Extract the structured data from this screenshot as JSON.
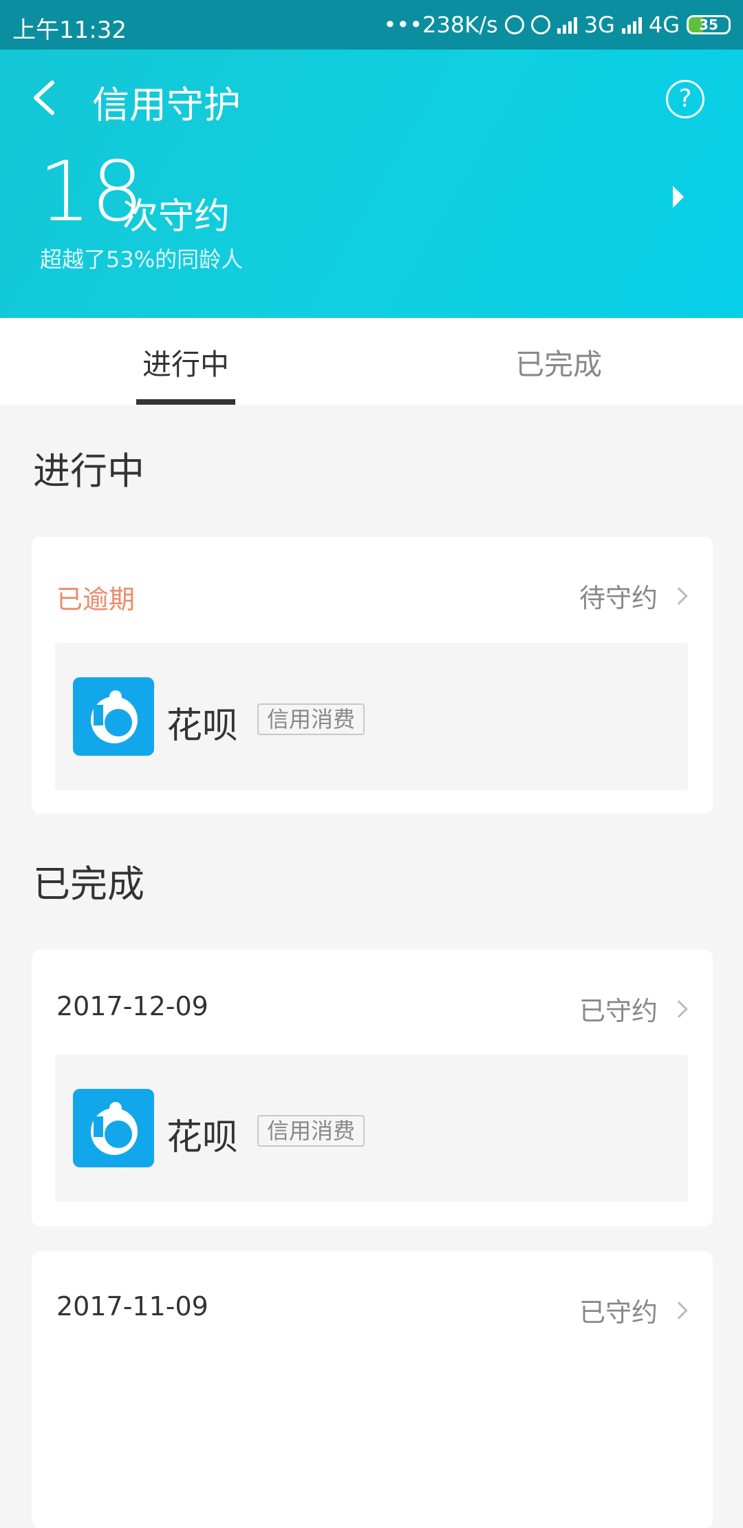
{
  "status_bar": {
    "time": "上午11:32",
    "speed": "•••238K/s",
    "network_3g": "3G",
    "network_4g": "4G",
    "battery": "35"
  },
  "header": {
    "title": "信用守护",
    "help_label": "?",
    "stats_number": "18",
    "stats_unit": "次守约",
    "stats_sub": "超越了53%的同龄人"
  },
  "tabs": [
    {
      "label": "进行中",
      "active": true
    },
    {
      "label": "已完成",
      "active": false
    }
  ],
  "sections": {
    "ongoing_title": "进行中",
    "done_title": "已完成"
  },
  "cards": [
    {
      "left_text": "已逾期",
      "right_text": "待守约",
      "app_name": "花呗",
      "app_tag": "信用消费"
    },
    {
      "left_text": "2017-12-09",
      "right_text": "已守约",
      "app_name": "花呗",
      "app_tag": "信用消费"
    },
    {
      "left_text": "2017-11-09",
      "right_text": "已守约"
    }
  ],
  "colors": {
    "accent": "#10cfe0",
    "overdue": "#f08a6a",
    "app_icon": "#12a7ea"
  }
}
